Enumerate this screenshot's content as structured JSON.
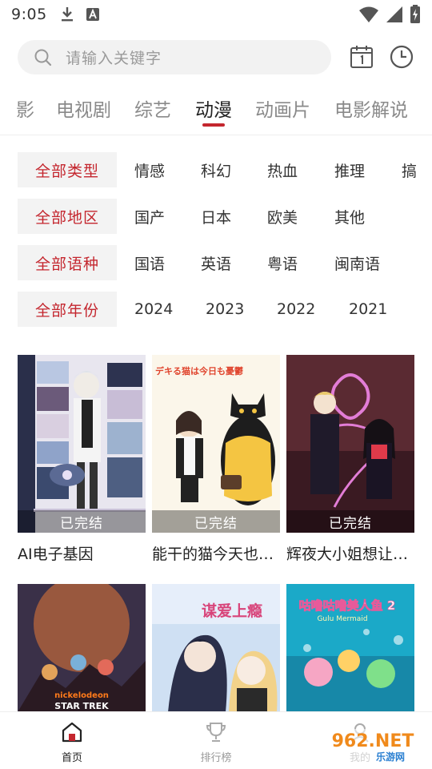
{
  "status_bar": {
    "time": "9:05"
  },
  "search": {
    "placeholder": "请输入关键字"
  },
  "tabs": [
    {
      "label": "影"
    },
    {
      "label": "电视剧"
    },
    {
      "label": "综艺"
    },
    {
      "label": "动漫"
    },
    {
      "label": "动画片"
    },
    {
      "label": "电影解说"
    }
  ],
  "active_tab": "动漫",
  "filters": {
    "type": {
      "all": "全部类型",
      "options": [
        "情感",
        "科幻",
        "热血",
        "推理",
        "搞"
      ]
    },
    "region": {
      "all": "全部地区",
      "options": [
        "国产",
        "日本",
        "欧美",
        "其他"
      ]
    },
    "language": {
      "all": "全部语种",
      "options": [
        "国语",
        "英语",
        "粤语",
        "闽南语"
      ]
    },
    "year": {
      "all": "全部年份",
      "options": [
        "2024",
        "2023",
        "2022",
        "2021"
      ]
    }
  },
  "items": [
    {
      "title": "AI电子基因",
      "status": "已完结"
    },
    {
      "title": "能干的猫今天也…",
      "status": "已完结"
    },
    {
      "title": "辉夜大小姐想让…",
      "status": "已完结"
    },
    {
      "title": "",
      "status": ""
    },
    {
      "title": "",
      "status": ""
    },
    {
      "title": "",
      "status": ""
    }
  ],
  "poster_texts": {
    "p2_title": "デキる猫は今日も憂鬱",
    "p5_title": "谋爱上瘾",
    "p6_title": "咕噜咕噜美人鱼 2",
    "p6_sub": "Gulu Mermaid",
    "p4_brand": "nickelodeon",
    "p4_title": "STAR TREK"
  },
  "bottom_nav": [
    {
      "label": "首页"
    },
    {
      "label": "排行榜"
    },
    {
      "label": "我的"
    }
  ],
  "watermark": {
    "text": "962.NET",
    "sub": "乐游网"
  },
  "colors": {
    "accent": "#c4262e",
    "muted": "#8a8a8a",
    "filter_bg": "#f3f3f3"
  }
}
